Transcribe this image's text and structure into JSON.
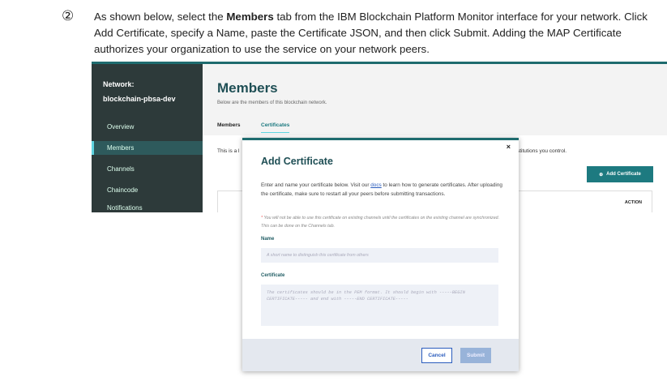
{
  "step_marker": "②",
  "instructions": {
    "pre": "As shown below, select the ",
    "bold": "Members",
    "post": " tab from the IBM Blockchain Platform Monitor interface for your network. Click Add Certificate, specify a Name, paste the Certificate JSON, and then click Submit. Adding the MAP Certificate authorizes your organization to use the service on your network peers."
  },
  "screenshot": {
    "sidebar": {
      "network_label": "Network:",
      "network_name": "blockchain-pbsa-dev",
      "items": [
        "Overview",
        "Members",
        "Channels",
        "Chaincode",
        "Notifications"
      ]
    },
    "page_title": "Members",
    "page_subtitle": "Below are the members of this blockchain network.",
    "tabs": [
      "Members",
      "Certificates"
    ],
    "intro_left": "This is a l",
    "intro_right": "stitutions you control.",
    "add_button": "Add Certificate",
    "table_header_action": "ACTION",
    "modal": {
      "close": "×",
      "title": "Add Certificate",
      "desc_pre": "Enter and name your certificate below. Visit our ",
      "desc_link": "docs",
      "desc_post": " to learn how to generate certificates. After uploading the certificate, make sure to restart all your peers before submitting transactions.",
      "note_star": "*",
      "note": " You will not be able to use this certificate on existing channels until the certificates on the existing channel are synchronized. This can be done on the Channels tab.",
      "name_label": "Name",
      "name_placeholder": "A short name to distinguish this certificate from others",
      "cert_label": "Certificate",
      "cert_placeholder": "The certificates should be in the PEM format. It should begin with -----BEGIN CERTIFICATE----- and end with -----END CERTIFICATE-----",
      "cancel": "Cancel",
      "submit": "Submit"
    }
  }
}
